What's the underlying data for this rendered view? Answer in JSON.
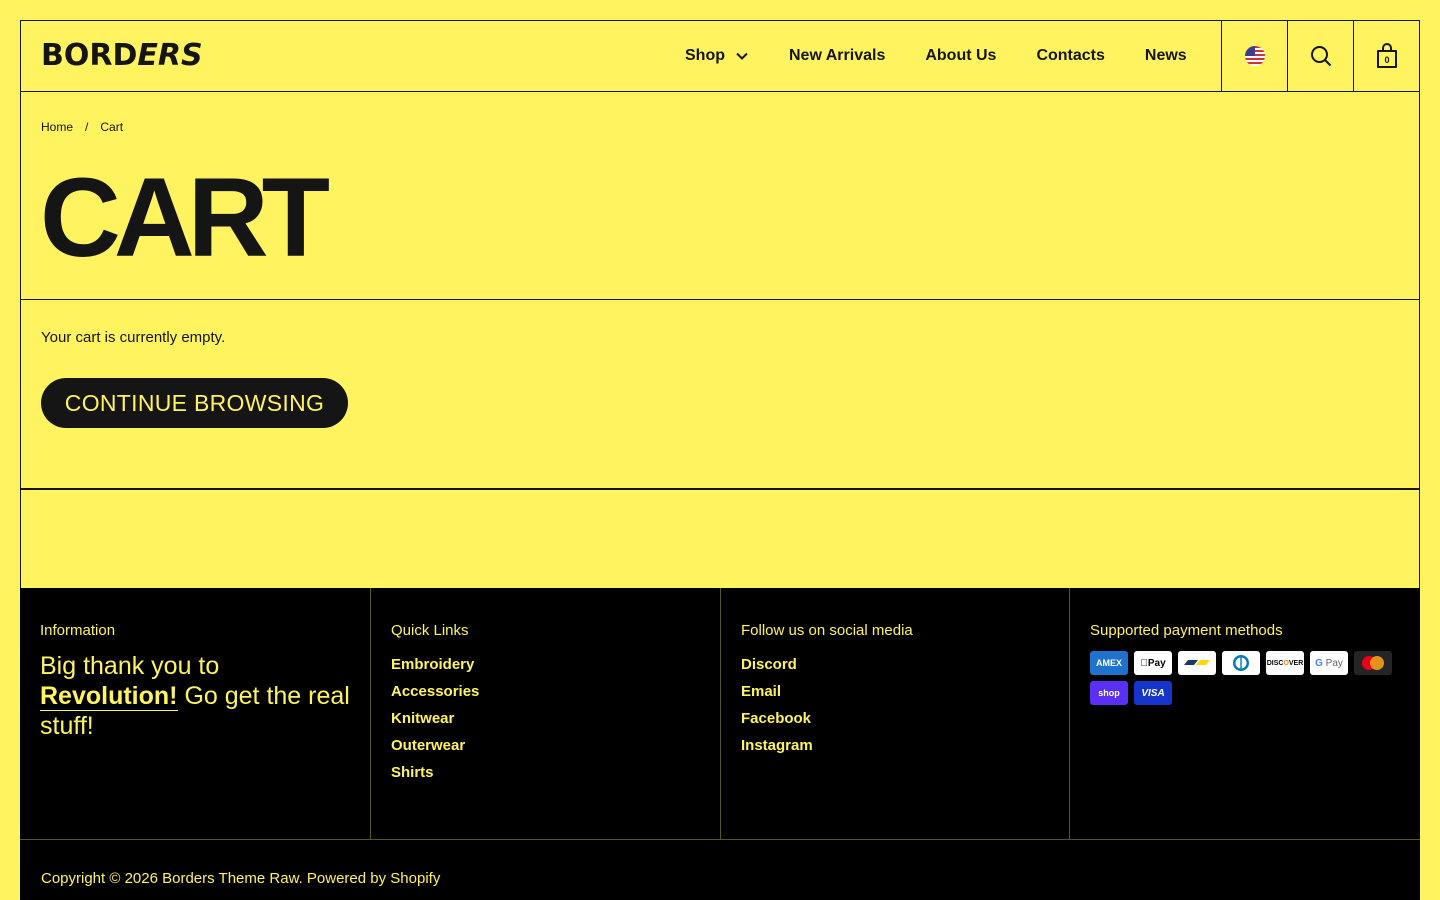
{
  "header": {
    "logo": "BORDERS",
    "nav": [
      "Shop",
      "New Arrivals",
      "About Us",
      "Contacts",
      "News"
    ],
    "cart_count": "0"
  },
  "breadcrumb": {
    "home": "Home",
    "separator": "/",
    "current": "Cart"
  },
  "page_title": "CART",
  "cart": {
    "empty_message": "Your cart is currently empty.",
    "continue_label": "CONTINUE BROWSING"
  },
  "footer": {
    "info": {
      "heading": "Information",
      "text_1": "Big thank you to",
      "text_bold": "Revolution!",
      "text_2": " Go get the real stuff!"
    },
    "quick_links": {
      "heading": "Quick Links",
      "items": [
        "Embroidery",
        "Accessories",
        "Knitwear",
        "Outerwear",
        "Shirts"
      ]
    },
    "social": {
      "heading": "Follow us on social media",
      "items": [
        "Discord",
        "Email",
        "Facebook",
        "Instagram"
      ]
    },
    "payments": {
      "heading": "Supported payment methods",
      "methods": [
        "American Express",
        "Apple Pay",
        "Bancontact",
        "Diners Club",
        "Discover",
        "Google Pay",
        "Mastercard",
        "Shop Pay",
        "Visa"
      ]
    },
    "copyright": "Copyright © 2026 Borders Theme Raw. Powered by Shopify"
  },
  "colors": {
    "background": "#fff35f",
    "ink": "#151515",
    "footer_bg": "#000000"
  }
}
